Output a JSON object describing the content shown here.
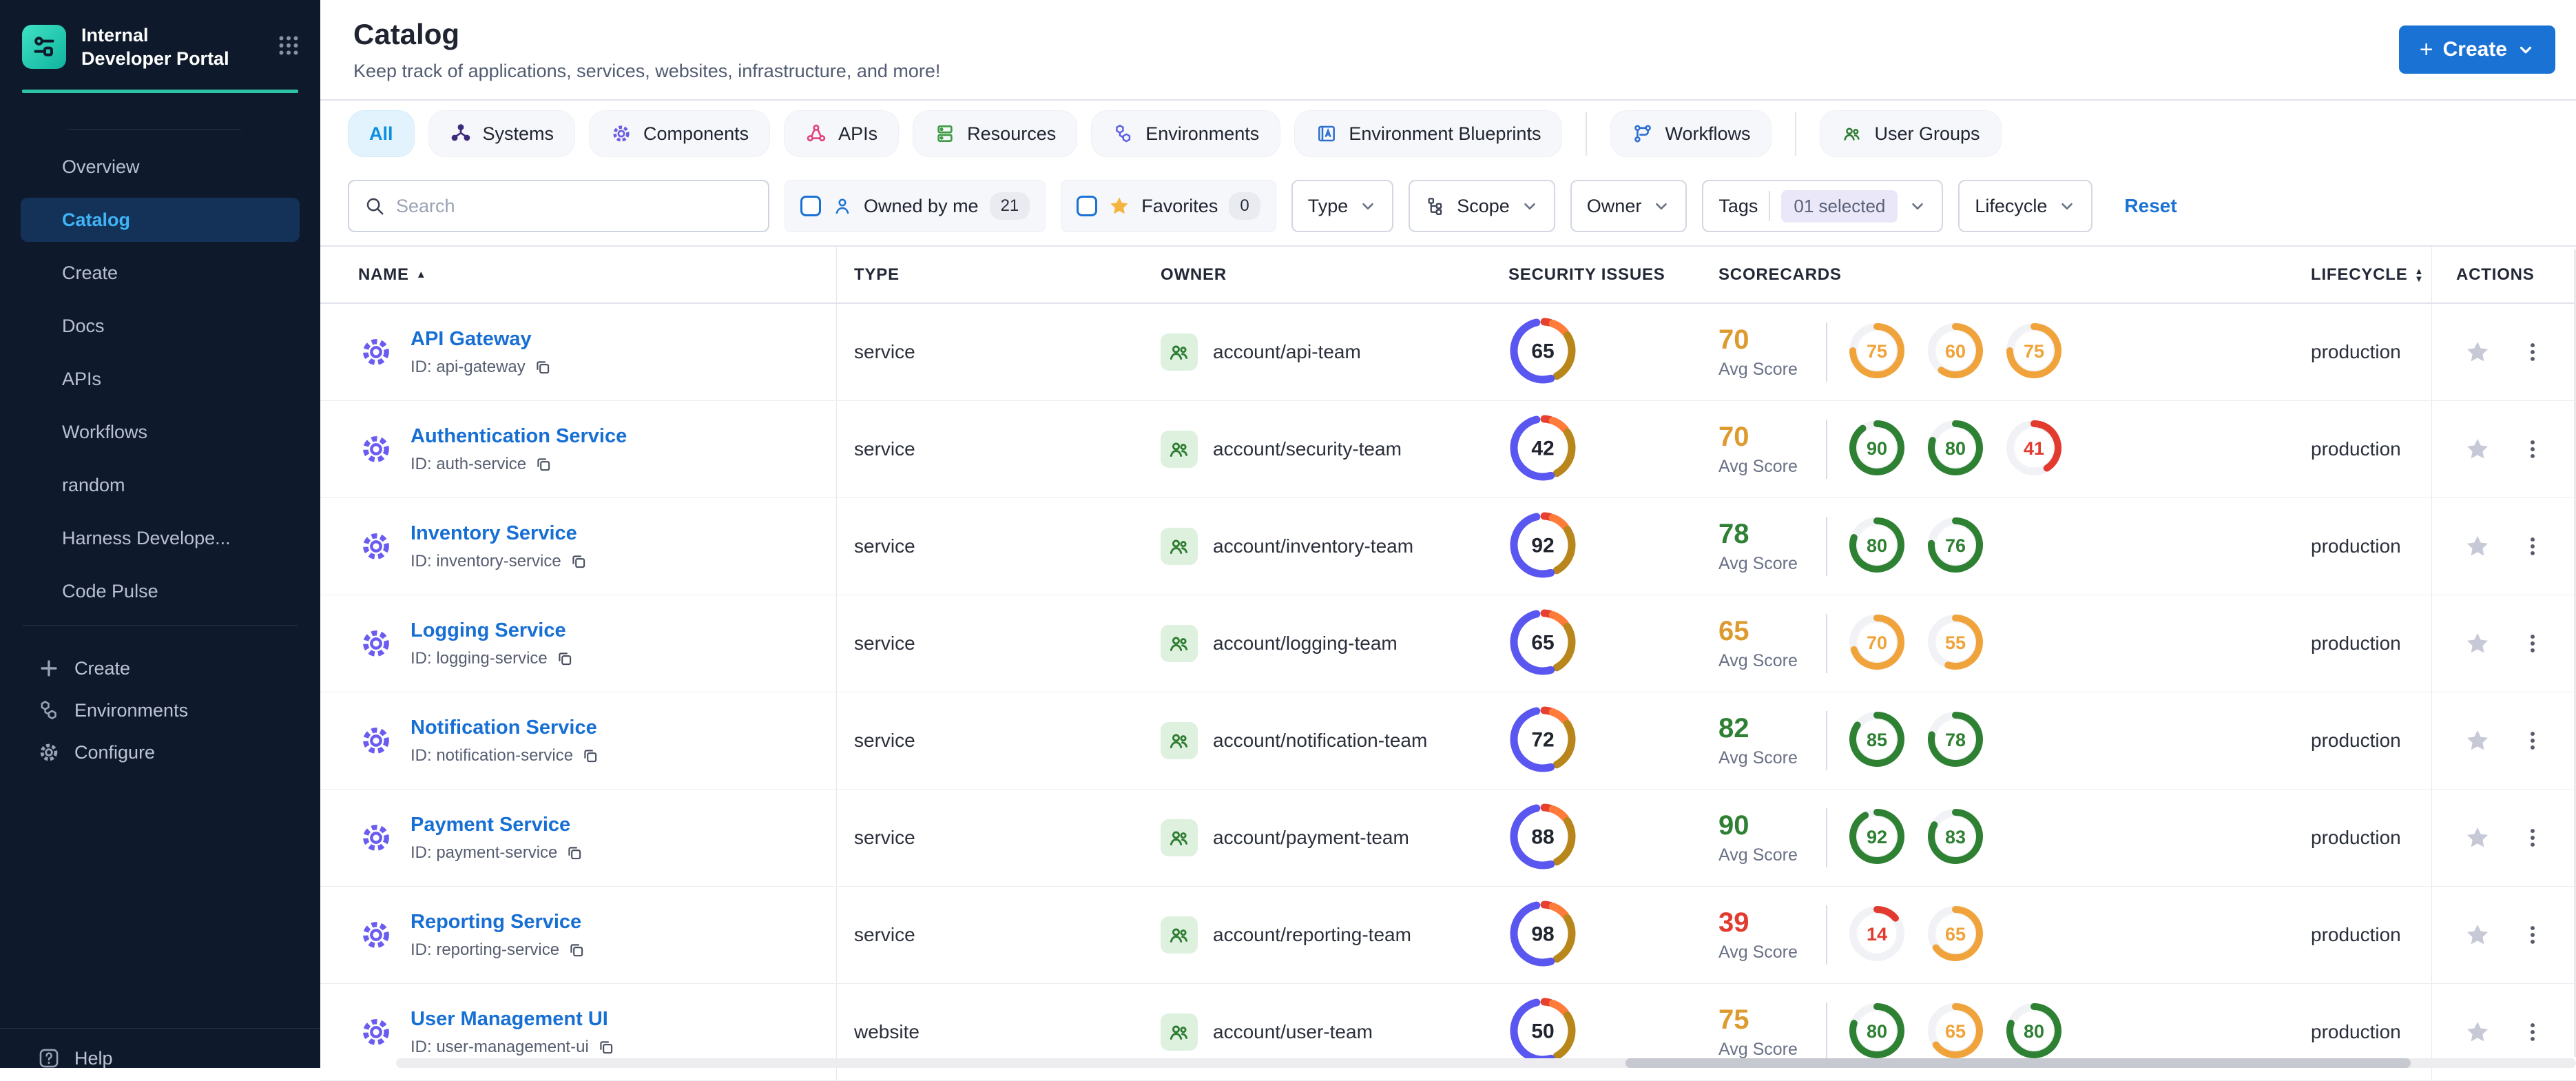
{
  "colors": {
    "green": "#2e8033",
    "orange": "#f0a33a",
    "red": "#e23a2e",
    "avg_green": "#2e8033",
    "avg_orange": "#dd9a2f",
    "avg_red": "#e23a2e",
    "donut_blue": "#5a57f0",
    "donut_olive": "#b9861c",
    "donut_orange": "#ff7b3a",
    "donut_red": "#e8402f",
    "accent_blue": "#1a72d4"
  },
  "sidebar": {
    "title": "Internal Developer Portal",
    "items": [
      "Overview",
      "Catalog",
      "Create",
      "Docs",
      "APIs",
      "Workflows",
      "random",
      "Harness Develope...",
      "Code Pulse"
    ],
    "active_item": "Catalog",
    "bottom_items": [
      {
        "label": "Create",
        "icon": "plus-icon"
      },
      {
        "label": "Environments",
        "icon": "hexagons-icon"
      },
      {
        "label": "Configure",
        "icon": "gear-icon"
      }
    ],
    "help_label": "Help"
  },
  "header": {
    "title": "Catalog",
    "subtitle": "Keep track of applications, services, websites, infrastructure, and more!",
    "create_label": "Create"
  },
  "tabs": [
    {
      "label": "All",
      "active": true
    },
    {
      "label": "Systems",
      "icon": "systems-icon",
      "color": "#3d2b7d"
    },
    {
      "label": "Components",
      "icon": "components-icon",
      "color": "#6a5ce0"
    },
    {
      "label": "APIs",
      "icon": "apis-icon",
      "color": "#e0447e"
    },
    {
      "label": "Resources",
      "icon": "resources-icon",
      "color": "#3f9c44"
    },
    {
      "label": "Environments",
      "icon": "hexagons-icon",
      "color": "#5b5ce2"
    },
    {
      "label": "Environment Blueprints",
      "icon": "blueprint-icon",
      "color": "#2f6fd0",
      "divider_after": true
    },
    {
      "label": "Workflows",
      "icon": "workflows-icon",
      "color": "#2f6fd0",
      "divider_after": true
    },
    {
      "label": "User Groups",
      "icon": "user-groups-icon",
      "color": "#2e7d32"
    }
  ],
  "filters": {
    "search_placeholder": "Search",
    "owned_by_me": {
      "label": "Owned by me",
      "count": "21"
    },
    "favorites": {
      "label": "Favorites",
      "count": "0"
    },
    "dropdowns": [
      {
        "label": "Type"
      },
      {
        "label": "Scope",
        "icon": "scope-icon"
      },
      {
        "label": "Owner"
      },
      {
        "label": "Tags",
        "selected": "01 selected"
      },
      {
        "label": "Lifecycle"
      }
    ],
    "reset_label": "Reset"
  },
  "table": {
    "columns": [
      {
        "label": "NAME",
        "sort": "asc"
      },
      {
        "label": "TYPE"
      },
      {
        "label": "OWNER"
      },
      {
        "label": "SECURITY ISSUES"
      },
      {
        "label": "SCORECARDS"
      },
      {
        "label": "LIFECYCLE",
        "sort": "both"
      },
      {
        "label": "ACTIONS"
      }
    ],
    "avg_score_label": "Avg Score",
    "id_prefix": "ID: ",
    "rows": [
      {
        "name": "API Gateway",
        "id": "api-gateway",
        "type": "service",
        "owner": "account/api-team",
        "security_issues": 65,
        "avg_score": 70,
        "avg_color": "orange",
        "scorecards": [
          {
            "value": 75,
            "color": "orange"
          },
          {
            "value": 60,
            "color": "orange"
          },
          {
            "value": 75,
            "color": "orange"
          }
        ],
        "lifecycle": "production"
      },
      {
        "name": "Authentication Service",
        "id": "auth-service",
        "type": "service",
        "owner": "account/security-team",
        "security_issues": 42,
        "avg_score": 70,
        "avg_color": "orange",
        "scorecards": [
          {
            "value": 90,
            "color": "green"
          },
          {
            "value": 80,
            "color": "green"
          },
          {
            "value": 41,
            "color": "red"
          }
        ],
        "lifecycle": "production"
      },
      {
        "name": "Inventory Service",
        "id": "inventory-service",
        "type": "service",
        "owner": "account/inventory-team",
        "security_issues": 92,
        "avg_score": 78,
        "avg_color": "green",
        "scorecards": [
          {
            "value": 80,
            "color": "green"
          },
          {
            "value": 76,
            "color": "green"
          }
        ],
        "lifecycle": "production"
      },
      {
        "name": "Logging Service",
        "id": "logging-service",
        "type": "service",
        "owner": "account/logging-team",
        "security_issues": 65,
        "avg_score": 65,
        "avg_color": "orange",
        "scorecards": [
          {
            "value": 70,
            "color": "orange"
          },
          {
            "value": 55,
            "color": "orange"
          }
        ],
        "lifecycle": "production"
      },
      {
        "name": "Notification Service",
        "id": "notification-service",
        "type": "service",
        "owner": "account/notification-team",
        "security_issues": 72,
        "avg_score": 82,
        "avg_color": "green",
        "scorecards": [
          {
            "value": 85,
            "color": "green"
          },
          {
            "value": 78,
            "color": "green"
          }
        ],
        "lifecycle": "production"
      },
      {
        "name": "Payment Service",
        "id": "payment-service",
        "type": "service",
        "owner": "account/payment-team",
        "security_issues": 88,
        "avg_score": 90,
        "avg_color": "green",
        "scorecards": [
          {
            "value": 92,
            "color": "green"
          },
          {
            "value": 83,
            "color": "green"
          }
        ],
        "lifecycle": "production"
      },
      {
        "name": "Reporting Service",
        "id": "reporting-service",
        "type": "service",
        "owner": "account/reporting-team",
        "security_issues": 98,
        "avg_score": 39,
        "avg_color": "red",
        "scorecards": [
          {
            "value": 14,
            "color": "red"
          },
          {
            "value": 65,
            "color": "orange"
          }
        ],
        "lifecycle": "production"
      },
      {
        "name": "User Management UI",
        "id": "user-management-ui",
        "type": "website",
        "owner": "account/user-team",
        "security_issues": 50,
        "avg_score": 75,
        "avg_color": "orange",
        "scorecards": [
          {
            "value": 80,
            "color": "green"
          },
          {
            "value": 65,
            "color": "orange"
          },
          {
            "value": 80,
            "color": "green"
          }
        ],
        "lifecycle": "production"
      }
    ]
  }
}
